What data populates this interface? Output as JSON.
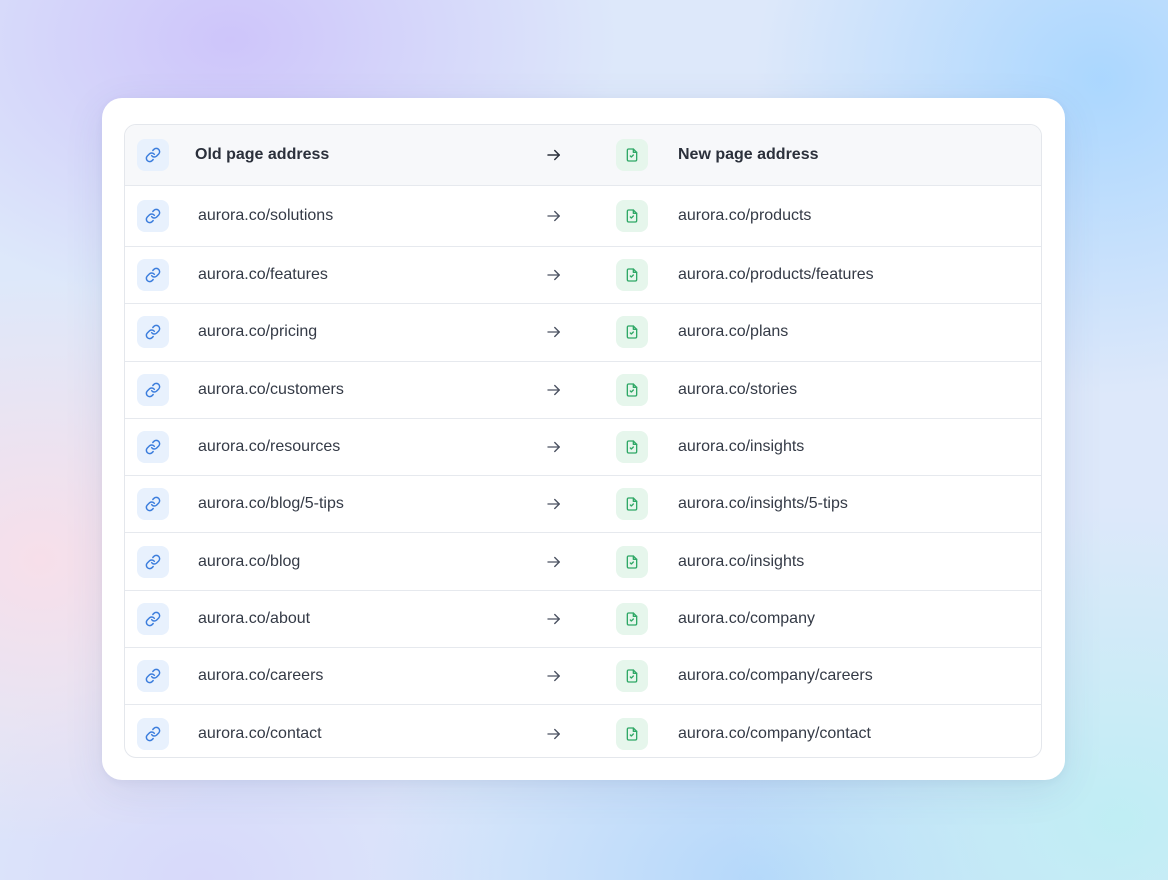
{
  "table": {
    "header": {
      "old_label": "Old page address",
      "new_label": "New page address",
      "old_icon": "link-icon",
      "new_icon": "file-icon",
      "arrow_icon": "arrow-right-icon"
    },
    "rows": [
      {
        "old": "aurora.co/solutions",
        "new": "aurora.co/products"
      },
      {
        "old": "aurora.co/features",
        "new": "aurora.co/products/features"
      },
      {
        "old": "aurora.co/pricing",
        "new": "aurora.co/plans"
      },
      {
        "old": "aurora.co/customers",
        "new": "aurora.co/stories"
      },
      {
        "old": "aurora.co/resources",
        "new": "aurora.co/insights"
      },
      {
        "old": "aurora.co/blog/5-tips",
        "new": "aurora.co/insights/5-tips"
      },
      {
        "old": "aurora.co/blog",
        "new": "aurora.co/insights"
      },
      {
        "old": "aurora.co/about",
        "new": "aurora.co/company"
      },
      {
        "old": "aurora.co/careers",
        "new": "aurora.co/company/careers"
      },
      {
        "old": "aurora.co/contact",
        "new": "aurora.co/company/contact"
      }
    ]
  },
  "colors": {
    "link_icon": "#3b7ddd",
    "link_icon_bg": "#e8f1fd",
    "file_icon": "#2fa866",
    "file_icon_bg": "#e6f6ec",
    "arrow": "#4a5160",
    "text": "#343a46"
  }
}
